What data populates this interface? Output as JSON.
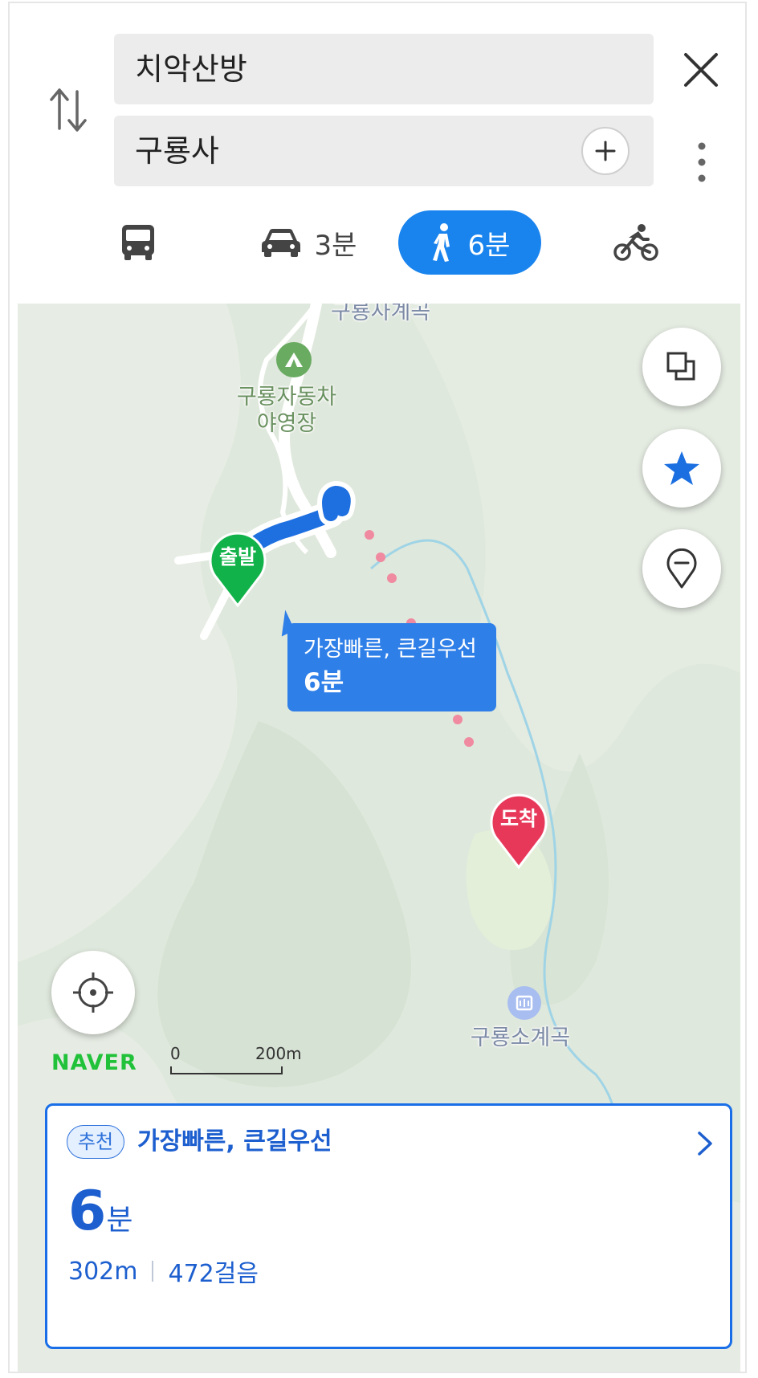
{
  "search": {
    "origin": "치악산방",
    "destination": "구룡사"
  },
  "modes": {
    "bus": "",
    "car": "3분",
    "walk": "6분",
    "bike": ""
  },
  "map": {
    "labels": {
      "valley_top": "구룡사계곡",
      "campground": "구룡자동차\n야영장",
      "valley_bottom": "구룡소계곡"
    },
    "start_marker": "출발",
    "end_marker": "도착",
    "route_tooltip": {
      "title": "가장빠른, 큰길우선",
      "time": "6분"
    },
    "logo": "NAVER",
    "scale": {
      "zero": "0",
      "distance": "200m"
    }
  },
  "result_card": {
    "badge": "추천",
    "title": "가장빠른, 큰길우선",
    "time_value": "6",
    "time_unit": "분",
    "distance": "302m",
    "steps": "472걸음"
  },
  "colors": {
    "accent": "#1a84ee",
    "card_blue": "#1d5fcf",
    "start_green": "#12b24a",
    "end_red": "#e8385a",
    "route_dots": "#f08aa0",
    "map_bg": "#dde7da"
  },
  "icons": [
    "swap-icon",
    "close-icon",
    "more-icon",
    "plus-icon",
    "bus-icon",
    "car-icon",
    "walk-icon",
    "bike-icon",
    "layers-icon",
    "star-icon",
    "pin-icon",
    "locate-icon",
    "camping-icon",
    "valley-icon",
    "chevron-right-icon"
  ]
}
